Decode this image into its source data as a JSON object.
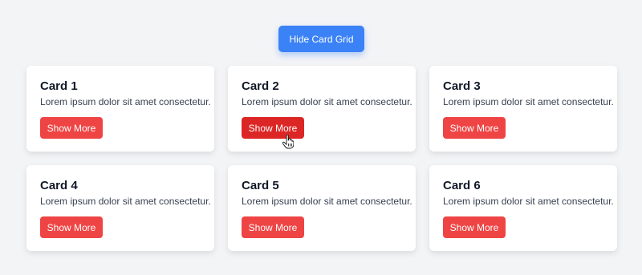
{
  "toolbar": {
    "toggle_label": "Hide Card Grid"
  },
  "cards": [
    {
      "title": "Card 1",
      "text": "Lorem ipsum dolor sit amet consectetur.",
      "button": "Show More"
    },
    {
      "title": "Card 2",
      "text": "Lorem ipsum dolor sit amet consectetur.",
      "button": "Show More"
    },
    {
      "title": "Card 3",
      "text": "Lorem ipsum dolor sit amet consectetur.",
      "button": "Show More"
    },
    {
      "title": "Card 4",
      "text": "Lorem ipsum dolor sit amet consectetur.",
      "button": "Show More"
    },
    {
      "title": "Card 5",
      "text": "Lorem ipsum dolor sit amet consectetur.",
      "button": "Show More"
    },
    {
      "title": "Card 6",
      "text": "Lorem ipsum dolor sit amet consectetur.",
      "button": "Show More"
    }
  ],
  "colors": {
    "background": "#f3f4f6",
    "primary_button": "#3b82f6",
    "card_button": "#ef4444",
    "card_button_hover": "#dc2626"
  },
  "cursor": {
    "icon": "hand-pointer-icon",
    "hovered_card": "Card 2"
  }
}
